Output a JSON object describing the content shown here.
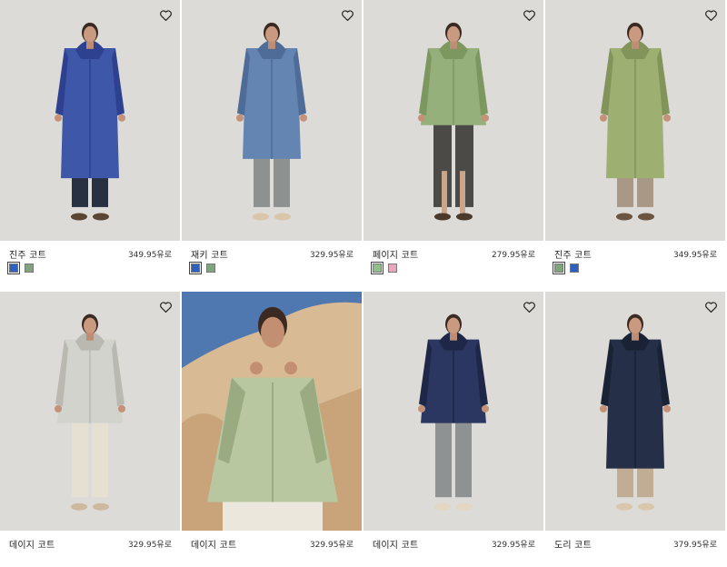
{
  "products": [
    {
      "name": "진주 코트",
      "price": "349.95유로",
      "icon": "heart-outline-icon",
      "swatches": [
        {
          "color": "#2f5fbf",
          "label": "blue"
        },
        {
          "color": "#7fa47e",
          "label": "green"
        }
      ],
      "coat": "#3f57a8",
      "coat_dark": "#2e4190",
      "pants": "#273142",
      "shoe": "#5a4633",
      "style": "long"
    },
    {
      "name": "재키 코트",
      "price": "329.95유로",
      "icon": "heart-outline-icon",
      "swatches": [
        {
          "color": "#2f5fbf",
          "label": "blue"
        },
        {
          "color": "#7fa47e",
          "label": "green"
        }
      ],
      "coat": "#6485b2",
      "coat_dark": "#4e6c97",
      "pants": "#8d918f",
      "shoe": "#d9c6a8",
      "style": "mid"
    },
    {
      "name": "페이지 코트",
      "price": "279.95유로",
      "icon": "heart-outline-icon",
      "swatches": [
        {
          "color": "#8fbf8a",
          "label": "green"
        },
        {
          "color": "#e8a8bc",
          "label": "pink"
        }
      ],
      "coat": "#95b07a",
      "coat_dark": "#7c975f",
      "pants": "#4c4a47",
      "shoe": "#4b3a2a",
      "style": "short"
    },
    {
      "name": "진주 코트",
      "price": "349.95유로",
      "icon": "heart-outline-icon",
      "swatches": [
        {
          "color": "#7fa47e",
          "label": "green"
        },
        {
          "color": "#2f5fbf",
          "label": "blue"
        }
      ],
      "coat": "#9eaf72",
      "coat_dark": "#82945a",
      "pants": "#a89885",
      "shoe": "#6b5541",
      "style": "long"
    },
    {
      "name": "데이지 코트",
      "price": "329.95유로",
      "icon": "heart-outline-icon",
      "coat": "#d3d3cd",
      "coat_dark": "#b9b9b2",
      "pants": "#e6e0d2",
      "shoe": "#cdb9a0",
      "style": "peplum"
    },
    {
      "name": "데이지 코트",
      "price": "329.95유로",
      "icon": "",
      "coat": "#b8c7a0",
      "coat_dark": "#9aab82",
      "pants": "#ece7dc",
      "shoe": "#cdb9a0",
      "style": "editorial"
    },
    {
      "name": "데이지 코트",
      "price": "329.95유로",
      "icon": "heart-outline-icon",
      "coat": "#2b3760",
      "coat_dark": "#1e2748",
      "pants": "#8f9292",
      "shoe": "#e3d7c2",
      "style": "peplum"
    },
    {
      "name": "도리 코트",
      "price": "379.95유로",
      "icon": "heart-outline-icon",
      "coat": "#252f47",
      "coat_dark": "#1a2235",
      "pants": "#c1ad94",
      "shoe": "#d8c7ad",
      "style": "long"
    }
  ]
}
